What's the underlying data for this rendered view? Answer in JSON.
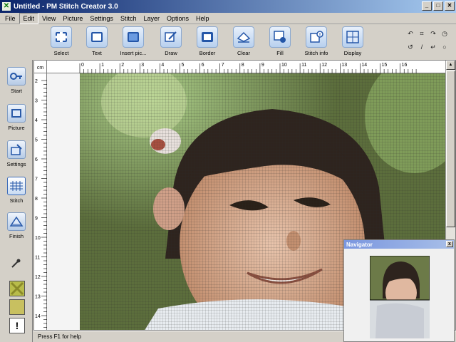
{
  "window": {
    "title": "Untitled - PM Stitch Creator 3.0",
    "min_label": "_",
    "max_label": "□",
    "close_label": "✕"
  },
  "menu": [
    "File",
    "Edit",
    "View",
    "Picture",
    "Settings",
    "Stitch",
    "Layer",
    "Options",
    "Help"
  ],
  "toolbar": [
    {
      "id": "select",
      "label": "Select",
      "icon": "select-icon"
    },
    {
      "id": "text",
      "label": "Text",
      "icon": "text-icon"
    },
    {
      "id": "insert-picture",
      "label": "Insert pic...",
      "icon": "insert-picture-icon"
    },
    {
      "id": "draw",
      "label": "Draw",
      "icon": "draw-pencil-icon"
    },
    {
      "id": "border",
      "label": "Border",
      "icon": "border-icon"
    },
    {
      "id": "clear",
      "label": "Clear",
      "icon": "eraser-icon"
    },
    {
      "id": "fill",
      "label": "Fill",
      "icon": "fill-bucket-icon"
    },
    {
      "id": "stitch-info",
      "label": "Stitch info",
      "icon": "stitch-info-icon"
    },
    {
      "id": "display",
      "label": "Display",
      "icon": "display-icon"
    }
  ],
  "mini_tools": [
    "↶",
    "⌗",
    "↷",
    "◷",
    "↺",
    "/",
    "↵",
    "○"
  ],
  "sidebar": [
    {
      "id": "start",
      "label": "Start",
      "icon": "start-key-icon"
    },
    {
      "id": "picture",
      "label": "Picture",
      "icon": "picture-icon"
    },
    {
      "id": "settings",
      "label": "Settings",
      "icon": "settings-icon"
    },
    {
      "id": "stitch",
      "label": "Stitch",
      "icon": "stitch-icon"
    },
    {
      "id": "finish",
      "label": "Finish",
      "icon": "finish-icon"
    }
  ],
  "sidebar_bottom": {
    "eyedropper": "eyedropper-icon",
    "swatch_colors": [
      "#b8bc4a",
      "#c8c060"
    ],
    "warning_label": "!"
  },
  "ruler": {
    "unit": "cm",
    "h_labels": [
      "0",
      "1",
      "2",
      "3",
      "4",
      "5",
      "6",
      "7",
      "8",
      "9",
      "10",
      "11",
      "12",
      "13",
      "14",
      "15",
      "16"
    ],
    "v_labels": [
      "2",
      "3",
      "4",
      "5",
      "6",
      "7",
      "8",
      "9",
      "10",
      "11",
      "12",
      "13",
      "14"
    ]
  },
  "status": {
    "text": "Press F1 for help"
  },
  "navigator": {
    "title": "Navigator",
    "close_label": "x"
  },
  "colors": {
    "titlebar": "#0a246a",
    "grid": "#2a2a2a",
    "background_photo": "#5a6a3a"
  }
}
